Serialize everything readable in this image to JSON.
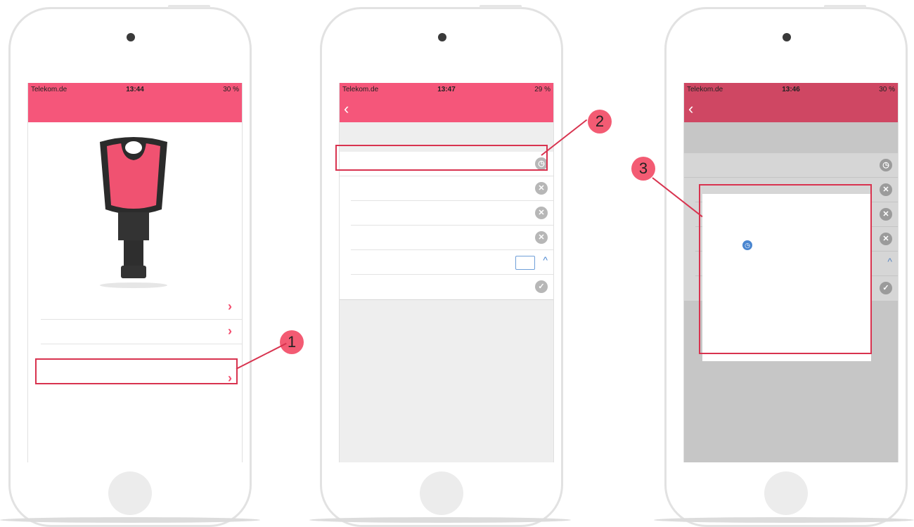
{
  "phones": [
    {
      "carrier": "Telekom.de",
      "time": "13:44",
      "battery": "30 %"
    },
    {
      "carrier": "Telekom.de",
      "time": "13:47",
      "battery": "29 %"
    },
    {
      "carrier": "Telekom.de",
      "time": "13:46",
      "battery": "30 %"
    }
  ],
  "callouts": [
    "1",
    "2",
    "3"
  ],
  "colors": {
    "accent": "#f5567a",
    "highlight": "#d8334f",
    "callout": "#f35b73"
  }
}
